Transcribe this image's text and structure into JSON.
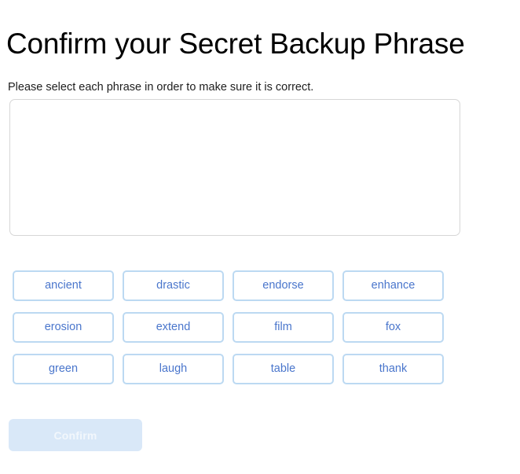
{
  "page": {
    "title": "Confirm your Secret Backup Phrase",
    "subtitle": "Please select each phrase in order to make sure it is correct."
  },
  "dropzone": {
    "name": "selected-phrase-area",
    "selected_words": [],
    "border_color": "#d6d6d6"
  },
  "word_grid": {
    "columns": 4,
    "words": [
      {
        "label": "ancient"
      },
      {
        "label": "drastic"
      },
      {
        "label": "endorse"
      },
      {
        "label": "enhance"
      },
      {
        "label": "erosion"
      },
      {
        "label": "extend"
      },
      {
        "label": "film"
      },
      {
        "label": "fox"
      },
      {
        "label": "green"
      },
      {
        "label": "laugh"
      },
      {
        "label": "table"
      },
      {
        "label": "thank"
      }
    ],
    "border_color": "#bcd9f2",
    "text_color": "#4a76cc"
  },
  "confirm_button": {
    "label": "Confirm",
    "disabled": true,
    "background_color": "#d9e8f8",
    "text_color": "#f2f7fc"
  }
}
